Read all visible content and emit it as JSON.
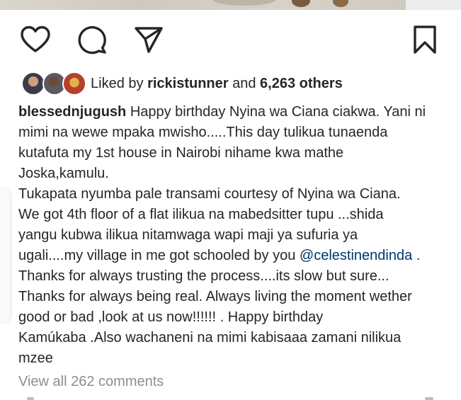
{
  "post": {
    "actions": {
      "like_icon": "heart-icon",
      "comment_icon": "comment-icon",
      "share_icon": "paper-plane-icon",
      "save_icon": "bookmark-icon"
    },
    "likes": {
      "prefix": "Liked by",
      "first_user": "rickistunner",
      "joiner": "and",
      "others": "6,263 others"
    },
    "caption": {
      "username": "blessednjugush",
      "lines": [
        "Happy birthday Nyina wa Ciana ciakwa. Yani ni",
        "mimi na wewe mpaka mwisho.....This day tulikua tunaenda",
        "kutafuta my 1st house in Nairobi nihame kwa mathe",
        "Joska,kamulu.",
        "Tukapata nyumba pale transami courtesy of Nyina wa Ciana.",
        "We got 4th floor of a flat ilikua na mabedsitter tupu ...shida",
        "yangu kubwa ilikua nitamwaga wapi maji ya sufuria ya",
        "ugali....my village in me got schooled by you",
        "Thanks for always trusting the process....its slow but sure...",
        "Thanks for always being real. Always living the moment wether",
        "good or bad ,look at us now!!!!!! . Happy birthday",
        "Kamúkaba .Also wachaneni na mimi kabisaaa zamani nilikua",
        "mzee"
      ],
      "mention": "@celestinendinda",
      "mention_suffix": "."
    },
    "view_comments": "View all 262 comments"
  }
}
